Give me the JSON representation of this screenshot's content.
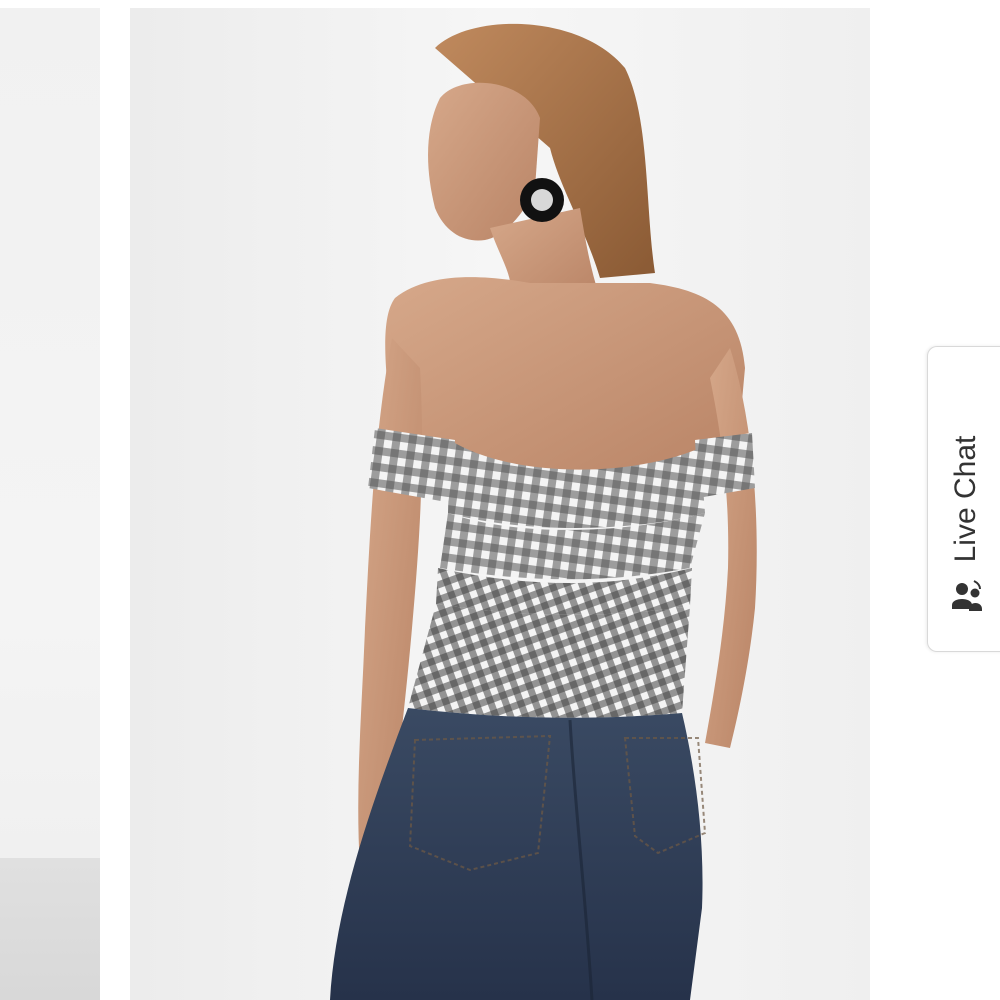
{
  "live_chat": {
    "label": "Live Chat",
    "icon": "chat-agents-icon"
  },
  "product_image": {
    "subject": "model-back-view",
    "background_color": "#f0f0f0"
  },
  "colors": {
    "accent_text": "#333333",
    "tab_border": "#d9d9d9"
  }
}
